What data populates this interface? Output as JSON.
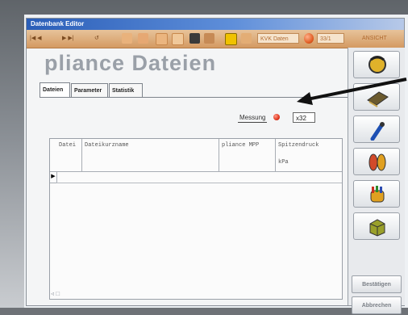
{
  "window": {
    "title": "Datenbank Editor"
  },
  "toolbar": {
    "nav_items": [
      "|◀ ◀",
      "▶ ▶|",
      "↺"
    ],
    "field_label": "KVK Daten",
    "right_field": "33/1",
    "right_label": "ANSICHT",
    "accent": "#d49a62"
  },
  "page": {
    "heading": "pliance Dateien"
  },
  "tabs": [
    "Dateien",
    "Parameter",
    "Statistik"
  ],
  "messung": {
    "label": "Messung",
    "value": "x32",
    "indicator_color": "#e0371f"
  },
  "grid": {
    "columns": [
      "Datei",
      "Dateikurzname",
      "pliance MPP",
      "Spitzendruck"
    ],
    "unit_row": [
      "",
      "",
      "",
      "kPa"
    ],
    "row_marker": "▶",
    "footer_indicator": "◃ □"
  },
  "sidebar": {
    "icons": [
      "head-icon",
      "notebook-icon",
      "sensor-pen-icon",
      "feet-icon",
      "hand-icon",
      "box-icon"
    ],
    "confirm_label": "Bestätigen",
    "cancel_label": "Abbrechen"
  }
}
